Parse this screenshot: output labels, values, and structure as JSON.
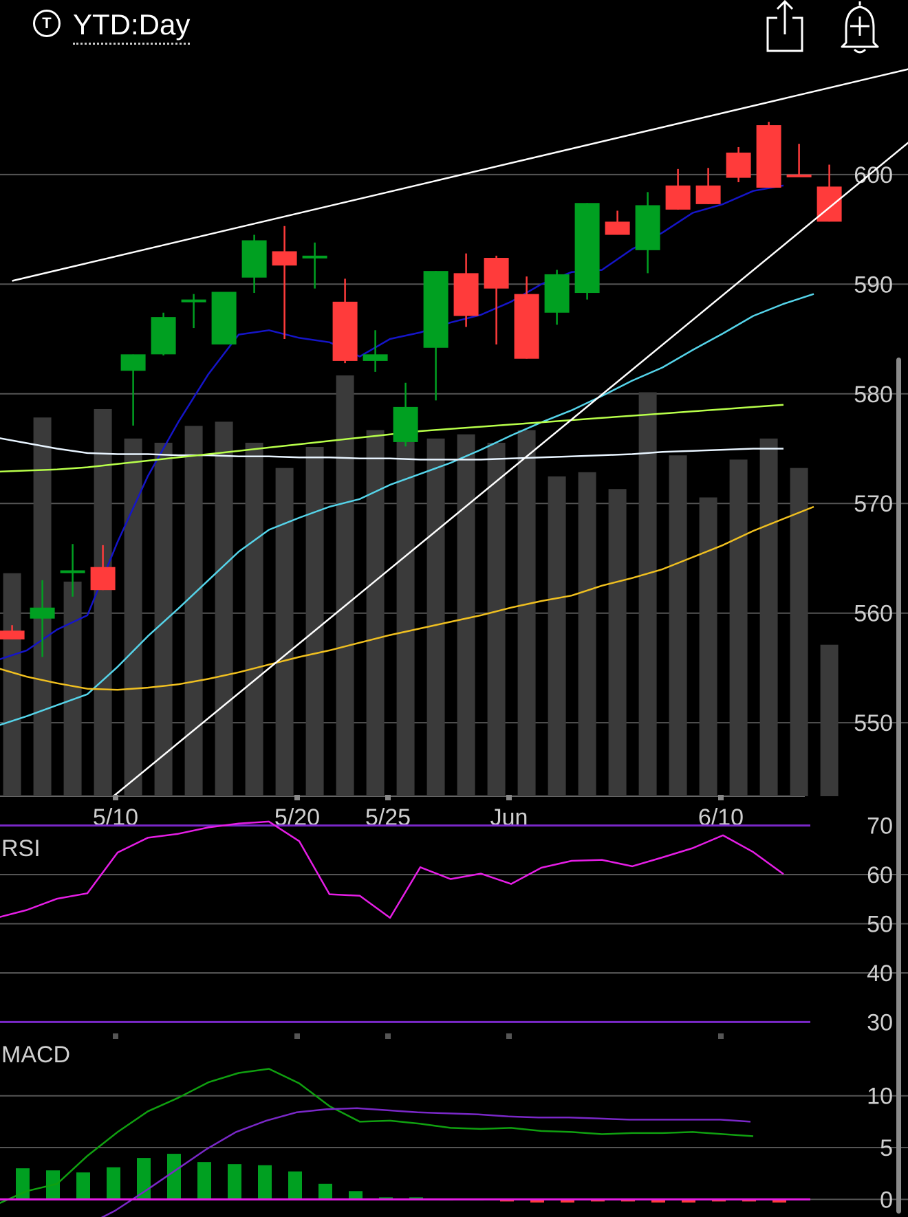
{
  "header": {
    "ticker_icon_letter": "T",
    "range_label": "YTD:Day",
    "share_icon": "share-icon",
    "alert_icon": "add-alert-bell-icon"
  },
  "colors": {
    "background": "#000000",
    "up_candle": "#00a021",
    "down_candle": "#ff3b3b",
    "volume": "#3a3a3a",
    "grid": "#555555",
    "ma_fast": "#1515c8",
    "ma_cyan": "#55d4ea",
    "ma_long_white": "#e8f4ff",
    "ma_green": "#b8ff4a",
    "ma_orange": "#f0c020",
    "trendline": "#ffffff",
    "rsi_line": "#e61ee6",
    "rsi_bounds": "#7a28c8",
    "macd_line": "#10a010",
    "macd_signal": "#7a28c8",
    "macd_hist_pos": "#00a021",
    "macd_hist_neg": "#ff3b3b",
    "macd_zero": "#e61ee6"
  },
  "chart_data": [
    {
      "type": "candlestick",
      "name": "price",
      "y_ticks": [
        600,
        590,
        580,
        570,
        560,
        550
      ],
      "ylim": [
        543.3,
        610.9
      ],
      "x_ticks": [
        {
          "label": "5/10",
          "index": 3
        },
        {
          "label": "5/20",
          "index": 9
        },
        {
          "label": "5/25",
          "index": 12
        },
        {
          "label": "Jun",
          "index": 16
        },
        {
          "label": "6/10",
          "index": 23
        }
      ],
      "x_positions": [
        -0.35,
        0.65,
        1.65,
        2.65,
        3.65,
        4.65,
        5.65,
        6.65,
        7.65,
        8.65,
        9.65,
        10.65,
        11.65,
        12.65,
        13.65,
        14.65,
        15.65,
        16.65,
        17.65,
        18.65,
        19.65,
        20.65,
        21.65,
        22.65,
        23.65,
        24.65,
        25.65,
        26.65
      ],
      "ohlc": [
        [
          558.4,
          558.9,
          557.7,
          557.6
        ],
        [
          559.5,
          563.0,
          556.0,
          560.5
        ],
        [
          563.9,
          566.3,
          561.5,
          563.9
        ],
        [
          564.2,
          566.2,
          563.2,
          562.1
        ],
        [
          582.1,
          583.1,
          577.1,
          583.6
        ],
        [
          583.6,
          587.4,
          583.5,
          587.0
        ],
        [
          588.6,
          589.1,
          586.0,
          588.6
        ],
        [
          584.5,
          584.6,
          585.5,
          589.3
        ],
        [
          590.6,
          594.5,
          589.2,
          594.0
        ],
        [
          593.0,
          595.3,
          585.0,
          591.7
        ],
        [
          592.6,
          593.8,
          589.6,
          592.6
        ],
        [
          588.4,
          590.5,
          582.8,
          583.0
        ],
        [
          583.0,
          585.8,
          582.0,
          583.6
        ],
        [
          575.6,
          581.0,
          575.2,
          578.8
        ],
        [
          584.2,
          591.2,
          579.4,
          591.2
        ],
        [
          591.0,
          592.8,
          586.1,
          587.1
        ],
        [
          592.4,
          592.6,
          584.5,
          589.6
        ],
        [
          589.1,
          589.8,
          590.7,
          583.2
        ],
        [
          587.4,
          591.3,
          586.3,
          590.9
        ],
        [
          589.2,
          595.2,
          588.6,
          597.4
        ],
        [
          595.7,
          596.7,
          594.5,
          594.5
        ],
        [
          593.1,
          598.4,
          591.0,
          597.2
        ],
        [
          599.0,
          599.0,
          600.5,
          596.8
        ],
        [
          599.0,
          600.6,
          599.7,
          597.3
        ],
        [
          602.0,
          602.5,
          599.3,
          599.7
        ],
        [
          604.5,
          600.6,
          604.8,
          598.8
        ],
        [
          600.0,
          602.8,
          600.0,
          599.8
        ],
        [
          598.9,
          600.9,
          598.4,
          595.7
        ]
      ],
      "volume_relative": [
        0.53,
        0.9,
        0.51,
        0.92,
        0.85,
        0.84,
        0.88,
        0.89,
        0.84,
        0.78,
        0.83,
        1.0,
        0.87,
        0.89,
        0.85,
        0.86,
        0.84,
        0.87,
        0.76,
        0.77,
        0.73,
        0.96,
        0.81,
        0.71,
        0.8,
        0.85,
        0.78,
        0.36
      ],
      "moving_averages": [
        {
          "color_key": "ma_fast",
          "values": [
            555.7,
            556.6,
            558.5,
            559.8,
            566.5,
            572.5,
            577.4,
            581.8,
            585.4,
            585.8,
            585.1,
            584.7,
            583.4,
            585.0,
            585.6,
            586.5,
            587.2,
            588.4,
            590.0,
            591.1,
            591.3,
            593.2,
            594.7,
            596.5,
            597.3,
            598.5,
            599.0
          ]
        },
        {
          "color_key": "ma_cyan",
          "values": [
            549.7,
            550.6,
            551.6,
            552.6,
            555.1,
            557.9,
            560.4,
            563.0,
            565.6,
            567.6,
            568.7,
            569.7,
            570.4,
            571.7,
            572.7,
            573.7,
            574.9,
            576.2,
            577.4,
            578.5,
            579.8,
            581.2,
            582.4,
            584.0,
            585.5,
            587.1,
            588.2,
            589.1
          ]
        },
        {
          "color_key": "ma_long_white",
          "values": [
            576.0,
            575.5,
            575.0,
            574.6,
            574.5,
            574.5,
            574.4,
            574.4,
            574.3,
            574.3,
            574.2,
            574.2,
            574.1,
            574.1,
            574.0,
            574.0,
            574.0,
            574.1,
            574.2,
            574.3,
            574.4,
            574.5,
            574.7,
            574.8,
            574.9,
            575.0,
            575.0
          ]
        },
        {
          "color_key": "ma_green",
          "values": [
            572.9,
            573.0,
            573.1,
            573.3,
            573.6,
            573.9,
            574.2,
            574.5,
            574.8,
            575.1,
            575.4,
            575.7,
            576.0,
            576.3,
            576.6,
            576.8,
            577.0,
            577.2,
            577.4,
            577.6,
            577.8,
            578.0,
            578.2,
            578.4,
            578.6,
            578.8,
            579.0
          ]
        },
        {
          "color_key": "ma_orange",
          "values": [
            555.0,
            554.2,
            553.6,
            553.1,
            553.0,
            553.2,
            553.5,
            554.0,
            554.6,
            555.3,
            556.0,
            556.6,
            557.3,
            558.0,
            558.6,
            559.2,
            559.8,
            560.5,
            561.1,
            561.6,
            562.5,
            563.2,
            564.0,
            565.1,
            566.2,
            567.5,
            568.6,
            569.7
          ]
        }
      ],
      "trendlines": [
        {
          "from_index": -0.35,
          "from_value": 590.3,
          "to_index": 29.4,
          "to_value": 609.7
        },
        {
          "from_index": 3.0,
          "from_value": 543.3,
          "to_index": 29.3,
          "to_value": 603.0
        }
      ]
    },
    {
      "type": "line",
      "name": "RSI",
      "title": "RSI",
      "y_ticks": [
        70,
        60,
        50,
        40,
        30
      ],
      "ylim": [
        26.7,
        73.3
      ],
      "bounds": [
        70,
        30
      ],
      "values": [
        51.2,
        52.8,
        55.1,
        56.2,
        64.5,
        67.5,
        68.3,
        69.6,
        70.4,
        70.8,
        66.8,
        56.0,
        55.7,
        51.2,
        61.5,
        59.1,
        60.2,
        58.1,
        61.4,
        62.8,
        63.0,
        61.7,
        63.5,
        65.4,
        68.0,
        64.6,
        60.1
      ]
    },
    {
      "type": "bar+line",
      "name": "MACD",
      "title": "MACD",
      "y_ticks": [
        10,
        5,
        0
      ],
      "ylim": [
        -1.7,
        12.9
      ],
      "macd": [
        -0.5,
        0.8,
        1.5,
        4.2,
        6.5,
        8.5,
        9.8,
        11.3,
        12.2,
        12.6,
        11.2,
        9.0,
        7.5,
        7.6,
        7.3,
        6.9,
        6.8,
        6.9,
        6.6,
        6.5,
        6.3,
        6.4,
        6.4,
        6.5,
        6.3,
        6.1
      ],
      "signal": [
        -5.5,
        -4.0,
        -2.6,
        -1.1,
        0.8,
        2.8,
        4.8,
        6.5,
        7.6,
        8.4,
        8.7,
        8.8,
        8.6,
        8.4,
        8.3,
        8.2,
        8.0,
        7.9,
        7.9,
        7.8,
        7.7,
        7.7,
        7.7,
        7.7,
        7.5
      ],
      "histogram": [
        3.0,
        2.8,
        2.6,
        3.1,
        4.0,
        4.4,
        3.6,
        3.4,
        3.3,
        2.7,
        1.5,
        0.8,
        0.2,
        0.2,
        0.0,
        0.0,
        -0.2,
        -0.3,
        -0.3,
        -0.2,
        -0.2,
        -0.3,
        -0.3,
        -0.2,
        -0.2,
        -0.3
      ]
    }
  ]
}
